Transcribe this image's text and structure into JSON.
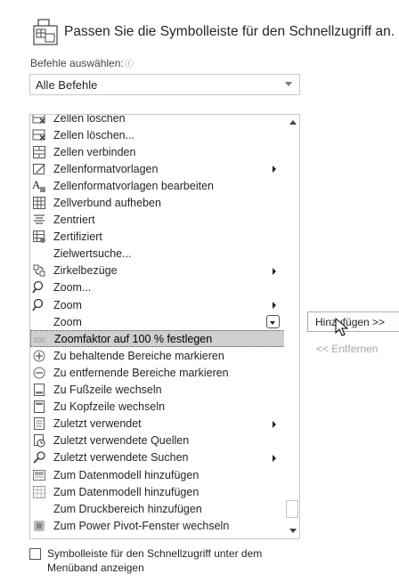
{
  "header": {
    "title": "Passen Sie die Symbolleiste für den Schnellzugriff an.",
    "icon": "customize-qat-icon"
  },
  "choose_commands": {
    "label": "Befehle auswählen:",
    "info_glyph": "ⓘ",
    "selected_value": "Alle Befehle"
  },
  "commands": [
    {
      "label": "Zellen löschen",
      "icon": "delete-cells-icon",
      "submenu": false
    },
    {
      "label": "Zellen löschen...",
      "icon": "delete-cells-dialog-icon",
      "submenu": false
    },
    {
      "label": "Zellen verbinden",
      "icon": "merge-cells-icon",
      "submenu": false
    },
    {
      "label": "Zellenformatvorlagen",
      "icon": "cell-styles-icon",
      "submenu": true
    },
    {
      "label": "Zellenformatvorlagen bearbeiten",
      "icon": "edit-cell-styles-icon",
      "submenu": false
    },
    {
      "label": "Zellverbund aufheben",
      "icon": "unmerge-cells-icon",
      "submenu": false
    },
    {
      "label": "Zentriert",
      "icon": "align-center-icon",
      "submenu": false
    },
    {
      "label": "Zertifiziert",
      "icon": "certified-icon",
      "submenu": false
    },
    {
      "label": "Zielwertsuche...",
      "icon": "",
      "submenu": false
    },
    {
      "label": "Zirkelbezüge",
      "icon": "circular-references-icon",
      "submenu": true
    },
    {
      "label": "Zoom...",
      "icon": "zoom-icon",
      "submenu": false
    },
    {
      "label": "Zoom",
      "icon": "zoom-icon",
      "submenu": true
    },
    {
      "label": "Zoom",
      "icon": "",
      "submenu": false,
      "combo": true
    },
    {
      "label": "Zoomfaktor auf 100 % festlegen",
      "icon": "zoom-100-icon",
      "submenu": false,
      "selected": true
    },
    {
      "label": "Zu behaltende Bereiche markieren",
      "icon": "mark-keep-areas-icon",
      "submenu": false
    },
    {
      "label": "Zu entfernende Bereiche markieren",
      "icon": "mark-remove-areas-icon",
      "submenu": false
    },
    {
      "label": "Zu Fußzeile wechseln",
      "icon": "go-to-footer-icon",
      "submenu": false
    },
    {
      "label": "Zu Kopfzeile wechseln",
      "icon": "go-to-header-icon",
      "submenu": false
    },
    {
      "label": "Zuletzt verwendet",
      "icon": "recently-used-icon",
      "submenu": true
    },
    {
      "label": "Zuletzt verwendete Quellen",
      "icon": "recent-sources-icon",
      "submenu": false
    },
    {
      "label": "Zuletzt verwendete Suchen",
      "icon": "recent-searches-icon",
      "submenu": true
    },
    {
      "label": "Zum Datenmodell hinzufügen",
      "icon": "add-to-data-model-icon",
      "submenu": false
    },
    {
      "label": "Zum Datenmodell hinzufügen",
      "icon": "add-table-data-model-icon",
      "submenu": false
    },
    {
      "label": "Zum Druckbereich hinzufügen",
      "icon": "",
      "submenu": false
    },
    {
      "label": "Zum Power Pivot-Fenster wechseln",
      "icon": "power-pivot-icon",
      "submenu": false
    }
  ],
  "buttons": {
    "add_label": "Hinzufügen >>",
    "remove_label": "<< Entfernen"
  },
  "checkbox": {
    "label": "Symbolleiste für den Schnellzugriff unter dem Menüband anzeigen",
    "checked": false
  },
  "colors": {
    "selection": "#cfcfcf",
    "text": "#262626",
    "disabled_text": "#a6a6a6"
  }
}
